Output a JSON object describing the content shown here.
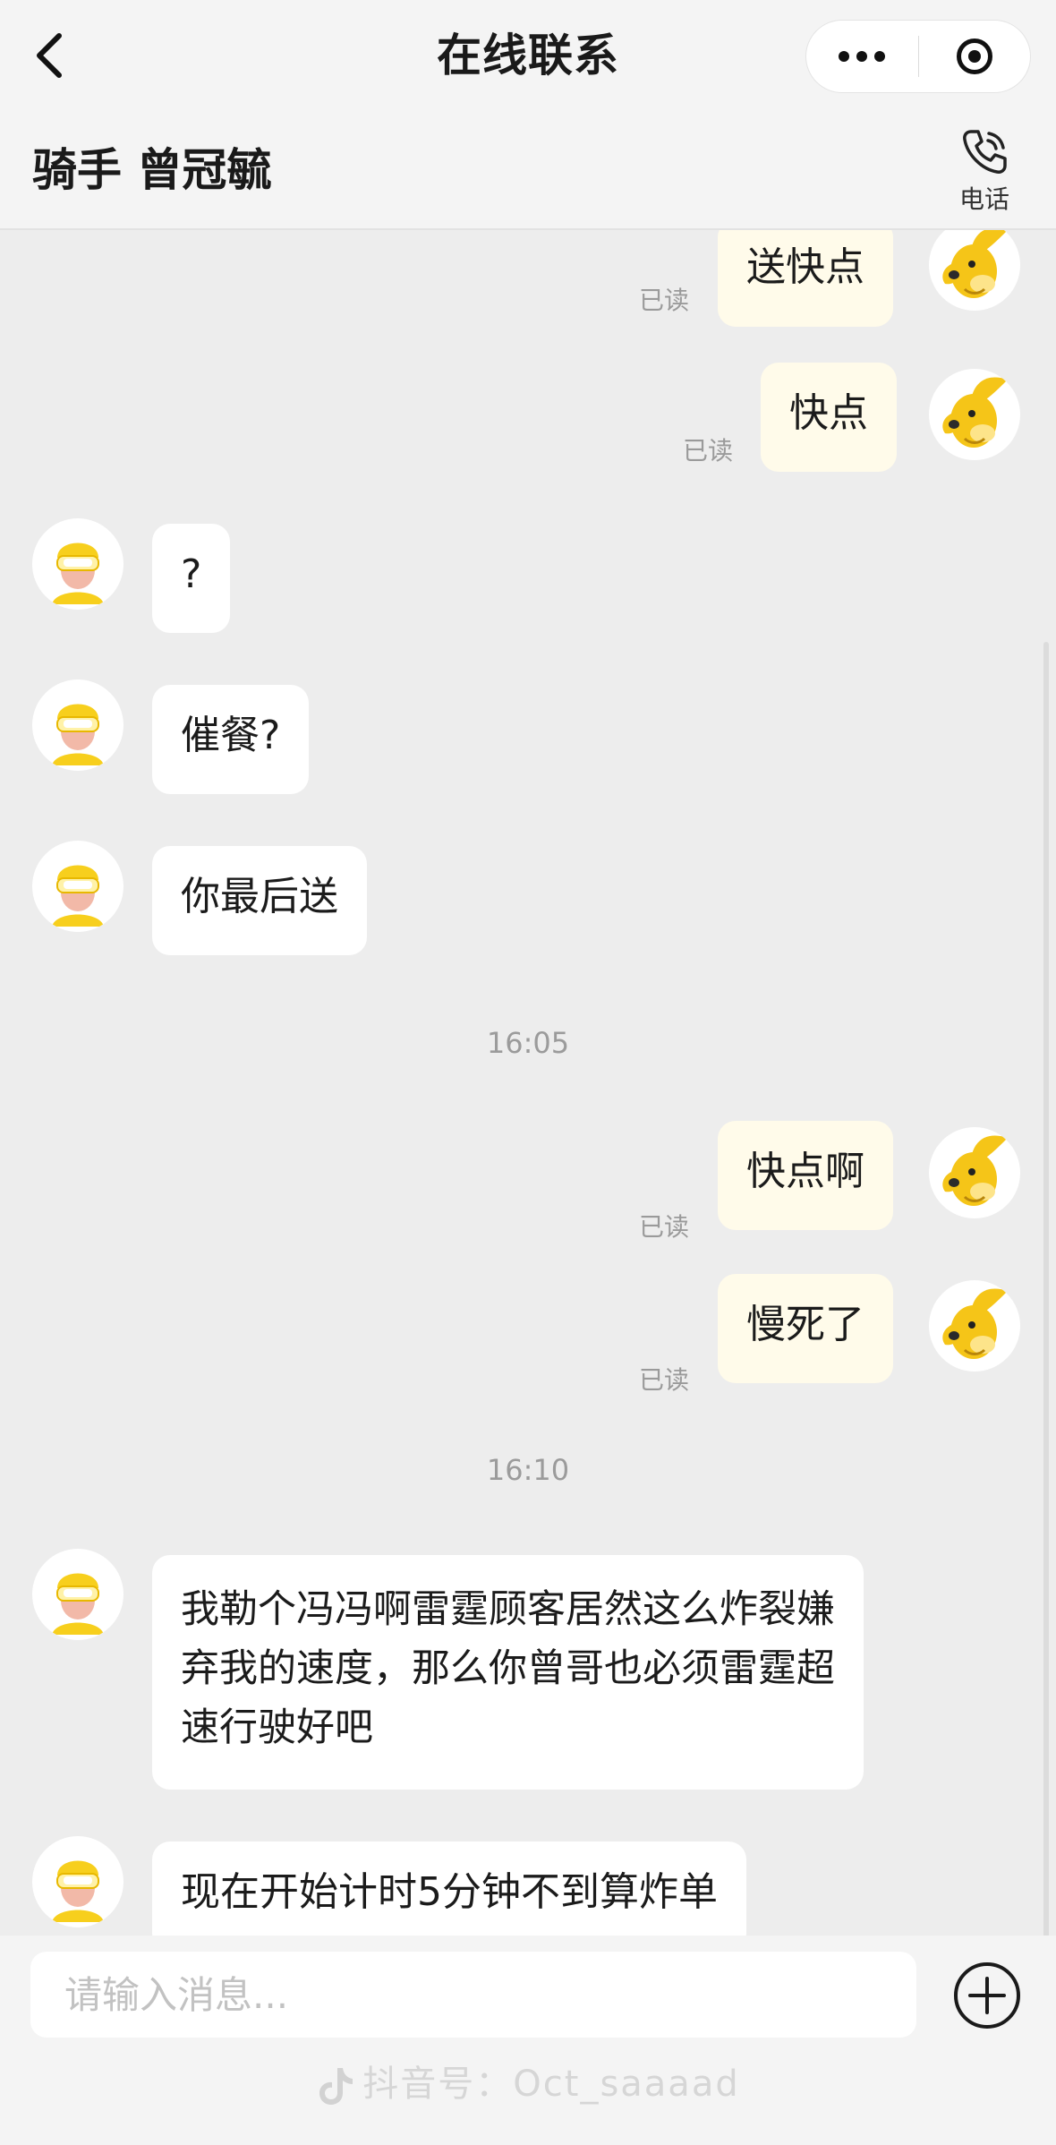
{
  "nav": {
    "title": "在线联系",
    "back_icon": "chevron-left-icon",
    "more_icon": "more-dots-icon",
    "target_icon": "target-circle-icon"
  },
  "rider": {
    "name": "骑手 曾冠毓",
    "call_label": "电话",
    "call_icon": "phone-icon"
  },
  "messages": [
    {
      "side": "me",
      "text": "送快点",
      "status": "已读"
    },
    {
      "side": "me",
      "text": "快点",
      "status": "已读"
    },
    {
      "side": "rider",
      "text": "?"
    },
    {
      "side": "rider",
      "text": "催餐?"
    },
    {
      "side": "rider",
      "text": "你最后送"
    },
    {
      "time": "16:05"
    },
    {
      "side": "me",
      "text": "快点啊",
      "status": "已读"
    },
    {
      "side": "me",
      "text": "慢死了",
      "status": "已读"
    },
    {
      "time": "16:10"
    },
    {
      "side": "rider",
      "text": "我勒个冯冯啊雷霆顾客居然这么炸裂嫌弃我的速度，那么你曾哥也必须雷霆超速行驶好吧"
    },
    {
      "side": "rider",
      "text": "现在开始计时5分钟不到算炸单"
    }
  ],
  "input": {
    "placeholder": "请输入消息...",
    "value": "",
    "plus_icon": "plus-circle-icon"
  },
  "watermark": {
    "text": "抖音号：Oct_saaaad",
    "icon": "tiktok-icon"
  },
  "colors": {
    "background": "#ededed",
    "header": "#f4f4f4",
    "my_bubble": "#fffbea",
    "rider_bubble": "#ffffff",
    "read_text": "#9a9a9a",
    "rider_helmet": "#f7cf1d",
    "mascot": "#f5c518"
  }
}
